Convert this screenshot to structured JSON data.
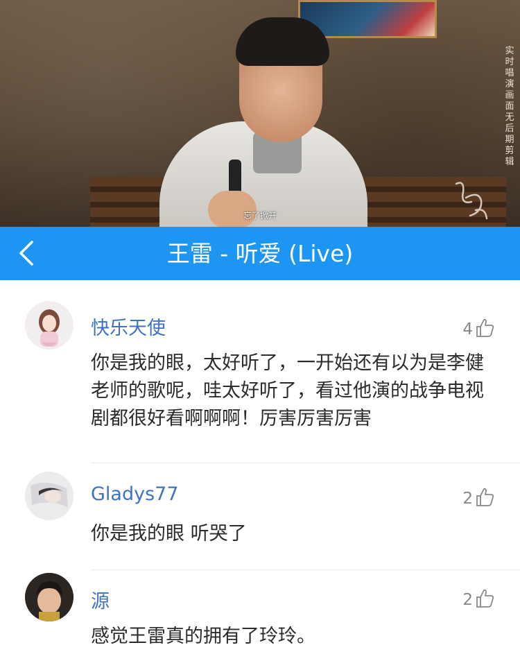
{
  "video": {
    "subtitle": "忘了掀开",
    "overlay_vertical_text": "实时唱演画面 无后期剪辑",
    "watermark": "幻乐之城"
  },
  "header": {
    "back_icon": "chevron-left-icon",
    "title": "王雷 - 听爱 (Live)",
    "background_color": "#1c96f2"
  },
  "comments": [
    {
      "username": "快乐天使",
      "likes": "4",
      "text": "你是我的眼，太好听了，一开始还有以为是李健老师的歌呢，哇太好听了，看过他演的战争电视剧都很好看啊啊啊！厉害厉害厉害"
    },
    {
      "username": "Gladys77",
      "likes": "2",
      "text": "你是我的眼 听哭了"
    },
    {
      "username": "源",
      "likes": "2",
      "text": "感觉王雷真的拥有了玲玲。"
    }
  ],
  "colors": {
    "username": "#3e72c2",
    "comment_text": "#2b2b2b",
    "like_count": "#888888"
  }
}
